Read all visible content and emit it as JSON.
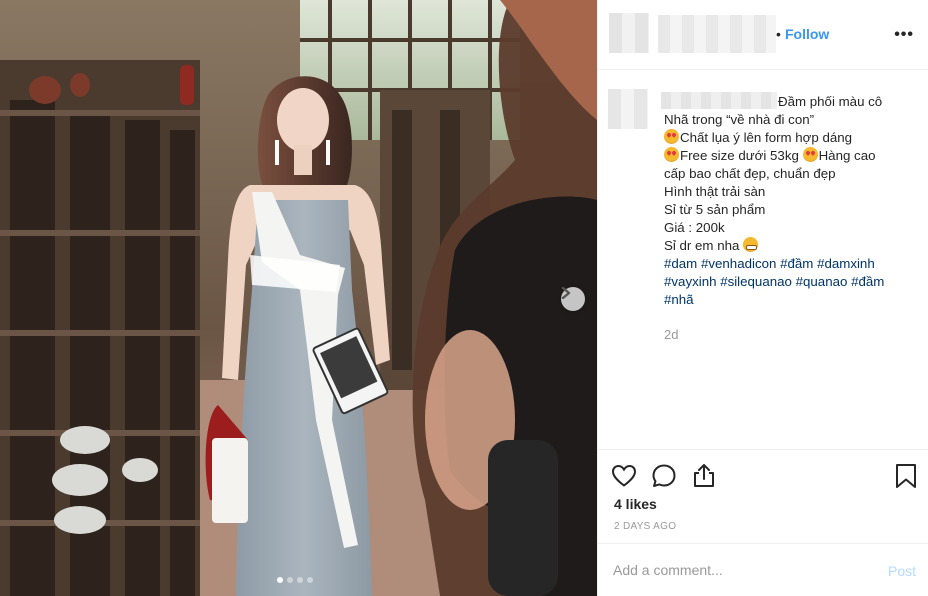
{
  "photo": {
    "carousel": {
      "count": 4,
      "active_index": 0
    },
    "next_icon": "chevron-right-icon"
  },
  "header": {
    "separator": "•",
    "follow_label": "Follow",
    "more_icon": "ellipsis-icon",
    "more_label": "•••"
  },
  "caption": {
    "lines": [
      "Đầm phối màu cô",
      "Nhã trong “về nhà đi con”",
      "Chất lụa ý lên form hợp dáng",
      "Free size dưới 53kg",
      "Hàng cao",
      "cấp bao chất đẹp, chuẩn đẹp",
      "Hình thật trải sàn",
      "Sỉ từ 5 sản phẩm",
      "Giá : 200k",
      "Sỉ dr em nha"
    ],
    "emoji": [
      "heart-eyes-emoji",
      "grinning-emoji"
    ],
    "hashtags": [
      "#dam",
      "#venhadicon",
      "#đầm",
      "#damxinh",
      "#vayxinh",
      "#silequanao",
      "#quanao",
      "#đầm",
      "#nhã"
    ],
    "time": "2d"
  },
  "actions": {
    "icons": [
      "heart-icon",
      "comment-icon",
      "share-icon",
      "bookmark-icon"
    ],
    "likes": "4 likes",
    "posted_ago": "2 DAYS AGO"
  },
  "comment_box": {
    "placeholder": "Add a comment...",
    "post_label": "Post"
  },
  "colors": {
    "link_blue": "#3897f0",
    "hashtag_blue": "#003569",
    "post_disabled": "#b3dbff",
    "border": "#efefef"
  }
}
